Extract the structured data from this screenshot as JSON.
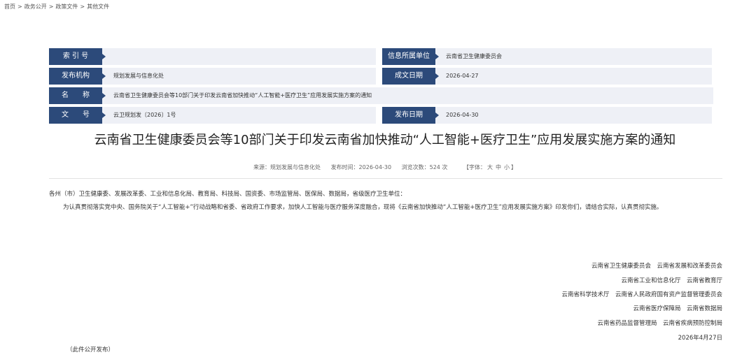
{
  "breadcrumb": [
    "首页",
    "政务公开",
    "政策文件",
    "其他文件"
  ],
  "meta": {
    "index_label": "索 引 号",
    "index_value": "",
    "owner_label": "信息所属单位",
    "owner_value": "云南省卫生健康委员会",
    "issuer_label": "发布机构",
    "issuer_value": "规划发展与信息化处",
    "written_label": "成文日期",
    "written_value": "2026-04-27",
    "name_label": "名　　称",
    "name_value": "云南省卫生健康委员会等10部门关于印发云南省加快推动“人工智能+医疗卫生”应用发展实施方案的通知",
    "docno_label": "文　　号",
    "docno_value": "云卫规划发〔2026〕1号",
    "pubdate_label": "发布日期",
    "pubdate_value": "2026-04-30"
  },
  "article": {
    "title": "云南省卫生健康委员会等10部门关于印发云南省加快推动“人工智能+医疗卫生”应用发展实施方案的通知",
    "source": "来源：规划发展与信息化处",
    "time": "发布时间：2026-04-30",
    "views": "浏览次数：524 次",
    "font_prefix": "【字体：",
    "font_large": "大",
    "font_medium": "中",
    "font_small": "小",
    "font_suffix": "】",
    "salutation": "各州（市）卫生健康委、发展改革委、工业和信息化局、教育局、科技局、国资委、市场监管局、医保局、数据局，省级医疗卫生单位：",
    "paragraph": "为认真贯彻落实党中央、国务院关于“人工智能+”行动战略和省委、省政府工作要求，加快人工智能与医疗服务深度融合，现将《云南省加快推动“人工智能+医疗卫生”应用发展实施方案》印发你们，请结合实际，认真贯彻实施。",
    "signatories": [
      "云南省卫生健康委员会　云南省发展和改革委员会",
      "云南省工业和信息化厅　云南省教育厅",
      "云南省科学技术厅　云南省人民政府国有资产监督管理委员会",
      "云南省医疗保障局　云南省数据局",
      "云南省药品监督管理局　云南省疾病预防控制局"
    ],
    "date": "2026年4月27日",
    "footer": "（此件公开发布）"
  }
}
